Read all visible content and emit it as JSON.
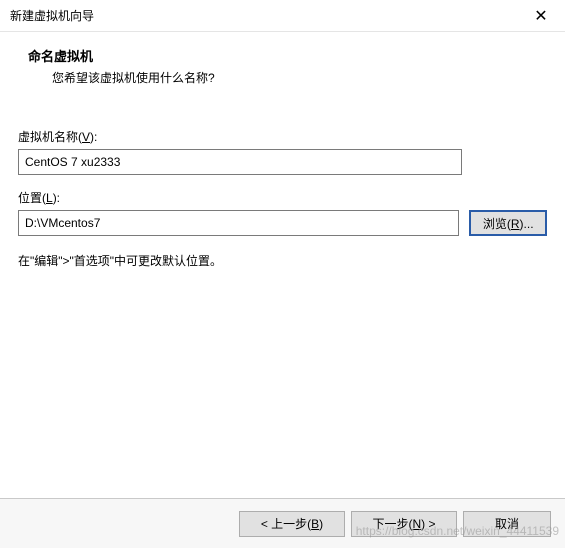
{
  "window": {
    "title": "新建虚拟机向导",
    "close_icon": "✕"
  },
  "header": {
    "title": "命名虚拟机",
    "subtitle": "您希望该虚拟机使用什么名称?"
  },
  "fields": {
    "name_label_pre": "虚拟机名称(",
    "name_label_key": "V",
    "name_label_post": "):",
    "name_value": "CentOS 7 xu2333",
    "loc_label_pre": "位置(",
    "loc_label_key": "L",
    "loc_label_post": "):",
    "loc_value": "D:\\VMcentos7",
    "browse_pre": "浏览(",
    "browse_key": "R",
    "browse_post": ")..."
  },
  "hint": "在\"编辑\">\"首选项\"中可更改默认位置。",
  "buttons": {
    "back_pre": "< 上一步(",
    "back_key": "B",
    "back_post": ")",
    "next_pre": "下一步(",
    "next_key": "N",
    "next_post": ") >",
    "cancel": "取消"
  },
  "watermark": "https://blog.csdn.net/weixin_44411539"
}
